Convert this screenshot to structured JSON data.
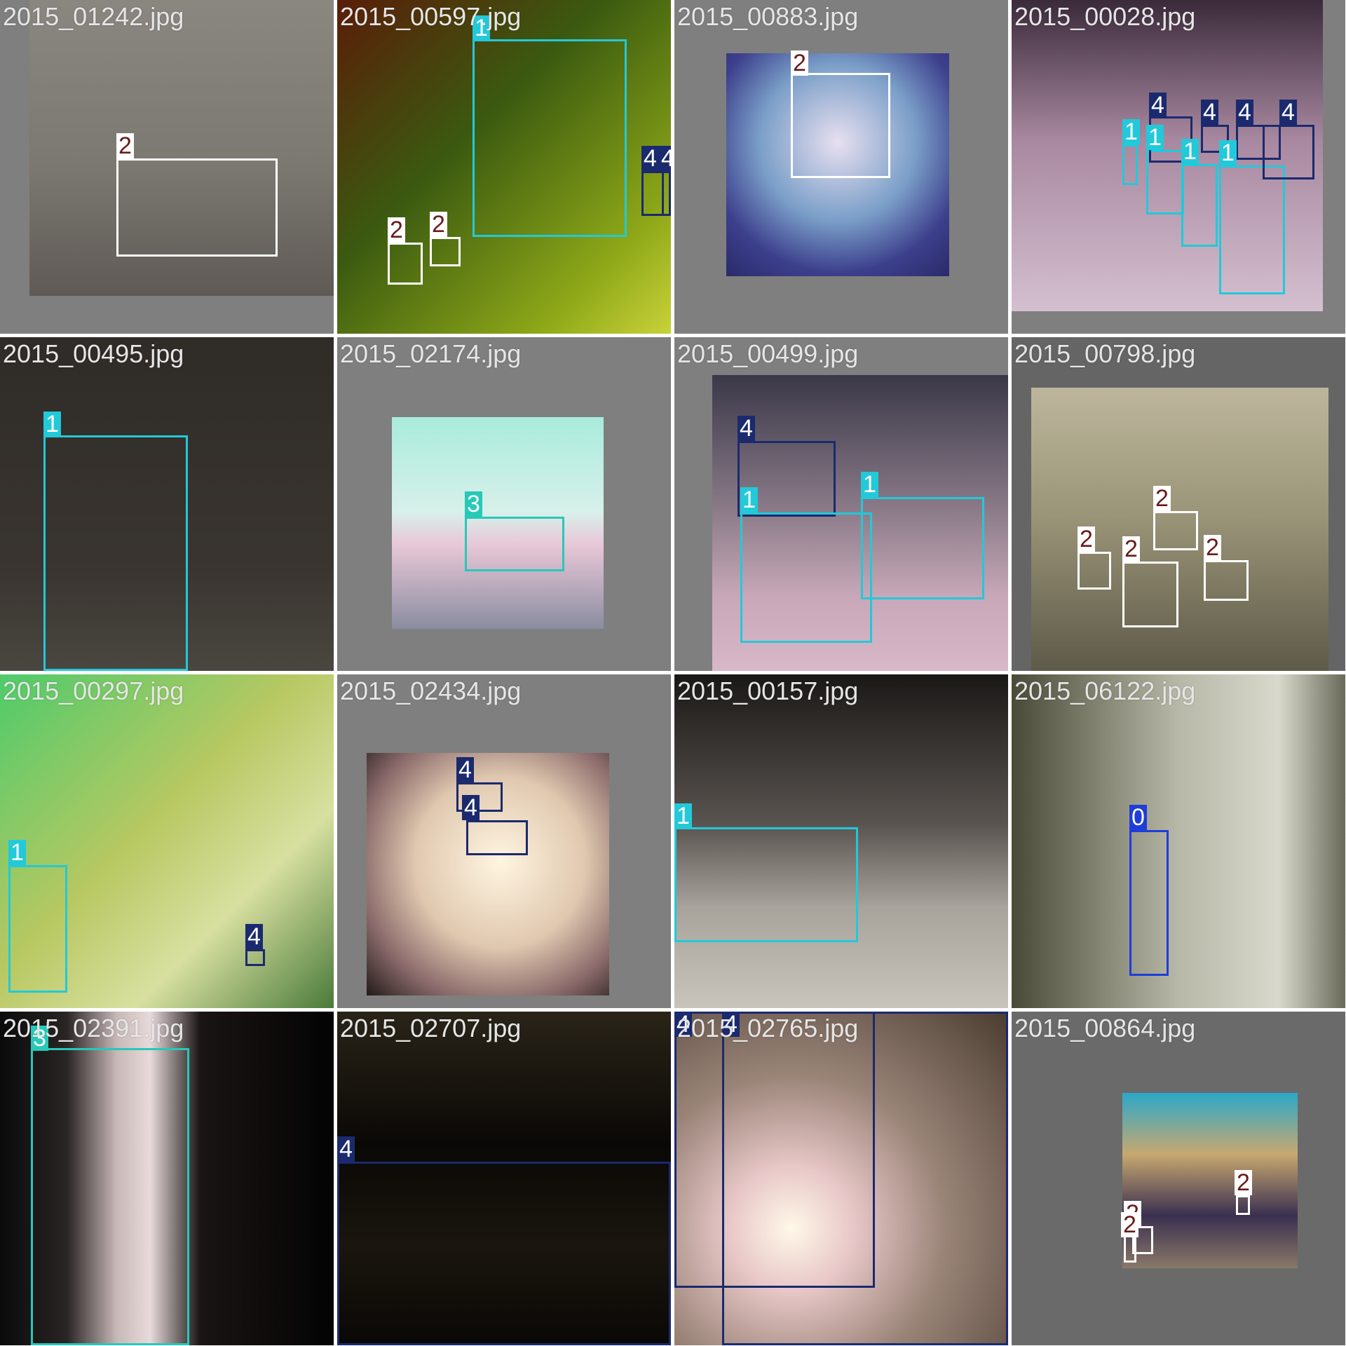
{
  "class_colors": {
    "0": "#1e3ddb",
    "1": "#22c9d9",
    "2": "#ffffff",
    "3": "#27c9b8",
    "4": "#1b2a6e"
  },
  "tiles": [
    {
      "filename": "2015_01242.jpg",
      "bg": "#7f7f7f",
      "photo": "linear-gradient(#8a8680,#7c7872 55%,#5f5a55)",
      "boxes": [
        {
          "label": "2",
          "cls": "2"
        }
      ]
    },
    {
      "filename": "2015_00597.jpg",
      "bg": "#7f7f7f",
      "photo": "linear-gradient(135deg,#5a1d08,#3b5a10 40%,#8ea818 80%,#c9d23a)",
      "boxes": [
        {
          "label": "1",
          "cls": "1"
        },
        {
          "label": "2",
          "cls": "2"
        },
        {
          "label": "2",
          "cls": "2"
        },
        {
          "label": "4",
          "cls": "4"
        },
        {
          "label": "4",
          "cls": "4"
        }
      ]
    },
    {
      "filename": "2015_00883.jpg",
      "bg": "#7f7f7f",
      "photo": "radial-gradient(circle at 50% 40%,#e8e0f0,#7a9ec8 45%,#3c3f8c 75%,#2a2a6a)",
      "boxes": [
        {
          "label": "2",
          "cls": "2"
        }
      ]
    },
    {
      "filename": "2015_00028.jpg",
      "bg": "#7f7f7f",
      "photo": "linear-gradient(#3a2a3a,#a888a0 45%,#d4c0d0)",
      "boxes": [
        {
          "label": "1",
          "cls": "1"
        },
        {
          "label": "1",
          "cls": "1"
        },
        {
          "label": "1",
          "cls": "1"
        },
        {
          "label": "1",
          "cls": "1"
        },
        {
          "label": "4",
          "cls": "4"
        },
        {
          "label": "4",
          "cls": "4"
        },
        {
          "label": "4",
          "cls": "4"
        },
        {
          "label": "4",
          "cls": "4"
        }
      ]
    },
    {
      "filename": "2015_00495.jpg",
      "bg": "#2e2a26",
      "photo": "linear-gradient(#2f2b27,#3a3530 70%,#4a4640)",
      "boxes": [
        {
          "label": "1",
          "cls": "1"
        }
      ]
    },
    {
      "filename": "2015_02174.jpg",
      "bg": "#7f7f7f",
      "photo": "linear-gradient(#a8ecdc,#d8f0ea 45%,#e8c8d8 60%,#8a8ca0)",
      "boxes": [
        {
          "label": "3",
          "cls": "3"
        }
      ]
    },
    {
      "filename": "2015_00499.jpg",
      "bg": "#7f7f7f",
      "photo": "linear-gradient(#3a3848,#8a7a88 45%,#c8a8b8 75%,#d8b8c8)",
      "boxes": [
        {
          "label": "4",
          "cls": "4"
        },
        {
          "label": "1",
          "cls": "1"
        },
        {
          "label": "1",
          "cls": "1"
        }
      ]
    },
    {
      "filename": "2015_00798.jpg",
      "bg": "#656565",
      "photo": "linear-gradient(#bdb69c,#9a9478 45%,#5e5a48)",
      "boxes": [
        {
          "label": "2",
          "cls": "2"
        },
        {
          "label": "2",
          "cls": "2"
        },
        {
          "label": "2",
          "cls": "2"
        },
        {
          "label": "2",
          "cls": "2"
        }
      ]
    },
    {
      "filename": "2015_00297.jpg",
      "bg": "#5a8a4a",
      "photo": "linear-gradient(135deg,#4ecb6a,#b8c862 45%,#d8e0a0 70%,#4a7a3a)",
      "boxes": [
        {
          "label": "1",
          "cls": "1"
        },
        {
          "label": "4",
          "cls": "4"
        }
      ]
    },
    {
      "filename": "2015_02434.jpg",
      "bg": "#7f7f7f",
      "photo": "radial-gradient(ellipse at 55% 45%,#fff5e0,#e0c8b0 45%,#8a6a6a 75%,#241a1a)",
      "boxes": [
        {
          "label": "4",
          "cls": "4"
        },
        {
          "label": "4",
          "cls": "4"
        }
      ]
    },
    {
      "filename": "2015_00157.jpg",
      "bg": "#151412",
      "photo": "linear-gradient(#1a1816,#5a5450 45%,#a8a49c 70%,#c8c4bc)",
      "boxes": [
        {
          "label": "1",
          "cls": "1"
        }
      ]
    },
    {
      "filename": "2015_06122.jpg",
      "bg": "#9a9a8a",
      "photo": "linear-gradient(90deg,#4a4a38,#b8b8a8 50%,#d8d8cc 80%,#6a6a5a)",
      "boxes": [
        {
          "label": "0",
          "cls": "0"
        }
      ]
    },
    {
      "filename": "2015_02391.jpg",
      "bg": "#050505",
      "photo": "linear-gradient(90deg,#0a0a0a,#2a2424 20%,#c8b8b8 35%,#e8dada 45%,#1a1414 60%,#030303)",
      "boxes": [
        {
          "label": "3",
          "cls": "3"
        }
      ]
    },
    {
      "filename": "2015_02707.jpg",
      "bg": "#050505",
      "photo": "linear-gradient(#2a2418,#0a0806 40%,#1a160e 70%,#0a0806)",
      "boxes": [
        {
          "label": "4",
          "cls": "4"
        }
      ]
    },
    {
      "filename": "2015_02765.jpg",
      "bg": "#3a3028",
      "photo": "radial-gradient(ellipse at 35% 65%,#fff8e8,#e8c8c8 20%,#9a8478 50%,#4a3c30)",
      "boxes": [
        {
          "label": "4",
          "cls": "4"
        },
        {
          "label": "4",
          "cls": "4"
        }
      ]
    },
    {
      "filename": "2015_00864.jpg",
      "bg": "#6a6a6a",
      "photo": "linear-gradient(#2ca8c8,#c8a870 35%,#3a3050 70%,#8a7868)",
      "boxes": [
        {
          "label": "2",
          "cls": "2"
        },
        {
          "label": "2",
          "cls": "2"
        },
        {
          "label": "2",
          "cls": "2"
        }
      ]
    }
  ]
}
